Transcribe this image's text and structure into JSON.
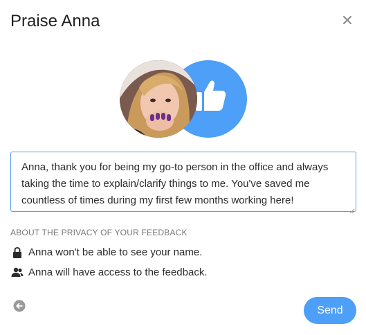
{
  "dialog": {
    "title": "Praise Anna"
  },
  "message": {
    "value": "Anna, thank you for being my go-to person in the office and always taking the time to explain/clarify things to me. You've saved me countless of times during my first few months working here!"
  },
  "privacy": {
    "heading": "ABOUT THE PRIVACY OF YOUR FEEDBACK",
    "items": [
      {
        "icon": "lock-icon",
        "text": "Anna won't be able to see your name."
      },
      {
        "icon": "people-icon",
        "text": "Anna will have access to the feedback."
      }
    ]
  },
  "footer": {
    "send_label": "Send"
  },
  "colors": {
    "accent": "#4d9ff7",
    "text": "#2b2b2b",
    "muted": "#777777"
  }
}
